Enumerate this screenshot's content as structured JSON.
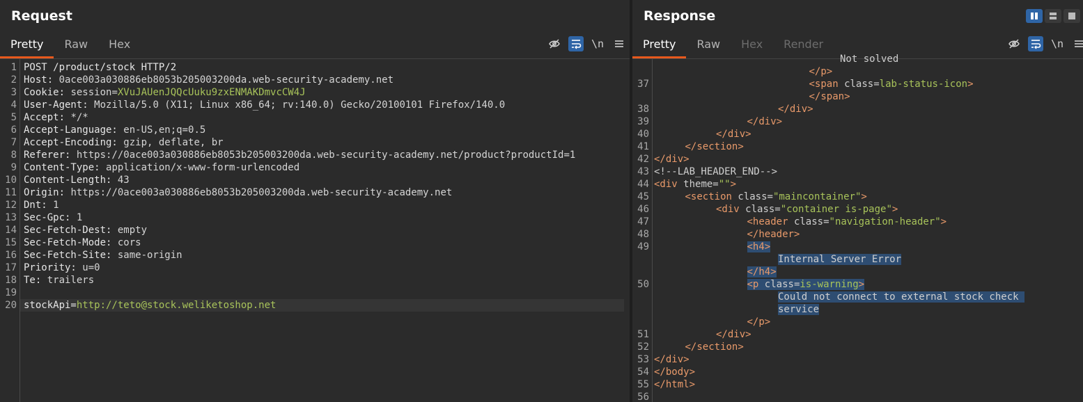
{
  "request": {
    "title": "Request",
    "tabs": [
      {
        "label": "Pretty",
        "active": true
      },
      {
        "label": "Raw",
        "active": false
      },
      {
        "label": "Hex",
        "active": false
      }
    ],
    "tools": {
      "newline_label": "\\n"
    },
    "lines": [
      {
        "n": "1",
        "key": "POST /product/stock HTTP/2",
        "val": "",
        "green": ""
      },
      {
        "n": "2",
        "key": "Host: ",
        "val": "0ace003a030886eb8053b205003200da.web-security-academy.net",
        "green": ""
      },
      {
        "n": "3",
        "key": "Cookie: ",
        "val": "session=",
        "green": "XVuJAUenJQQcUuku9zxENMAKDmvcCW4J"
      },
      {
        "n": "4",
        "key": "User-Agent: ",
        "val": "Mozilla/5.0 (X11; Linux x86_64; rv:140.0) Gecko/20100101 Firefox/140.0",
        "green": ""
      },
      {
        "n": "5",
        "key": "Accept: ",
        "val": "*/*",
        "green": ""
      },
      {
        "n": "6",
        "key": "Accept-Language: ",
        "val": "en-US,en;q=0.5",
        "green": ""
      },
      {
        "n": "7",
        "key": "Accept-Encoding: ",
        "val": "gzip, deflate, br",
        "green": ""
      },
      {
        "n": "8",
        "key": "Referer: ",
        "val": "https://0ace003a030886eb8053b205003200da.web-security-academy.net/product?productId=1",
        "green": ""
      },
      {
        "n": "9",
        "key": "Content-Type: ",
        "val": "application/x-www-form-urlencoded",
        "green": ""
      },
      {
        "n": "10",
        "key": "Content-Length: ",
        "val": "43",
        "green": ""
      },
      {
        "n": "11",
        "key": "Origin: ",
        "val": "https://0ace003a030886eb8053b205003200da.web-security-academy.net",
        "green": ""
      },
      {
        "n": "12",
        "key": "Dnt: ",
        "val": "1",
        "green": ""
      },
      {
        "n": "13",
        "key": "Sec-Gpc: ",
        "val": "1",
        "green": ""
      },
      {
        "n": "14",
        "key": "Sec-Fetch-Dest: ",
        "val": "empty",
        "green": ""
      },
      {
        "n": "15",
        "key": "Sec-Fetch-Mode: ",
        "val": "cors",
        "green": ""
      },
      {
        "n": "16",
        "key": "Sec-Fetch-Site: ",
        "val": "same-origin",
        "green": ""
      },
      {
        "n": "17",
        "key": "Priority: ",
        "val": "u=0",
        "green": ""
      },
      {
        "n": "18",
        "key": "Te: ",
        "val": "trailers",
        "green": ""
      },
      {
        "n": "19",
        "key": "",
        "val": "",
        "green": ""
      },
      {
        "n": "20",
        "key": "stockApi=",
        "val": "",
        "green": "http://teto@stock.weliketoshop.net"
      }
    ]
  },
  "response": {
    "title": "Response",
    "tabs": [
      {
        "label": "Pretty",
        "active": true
      },
      {
        "label": "Raw",
        "active": false
      },
      {
        "label": "Hex",
        "active": false,
        "disabled": true
      },
      {
        "label": "Render",
        "active": false,
        "disabled": true
      }
    ],
    "tools": {
      "newline_label": "\\n"
    },
    "lines": [
      {
        "n": "",
        "indent": 6,
        "parts": [
          {
            "c": "a",
            "t": "Not solved"
          }
        ]
      },
      {
        "n": "",
        "indent": 5,
        "parts": [
          {
            "c": "t",
            "t": "</p>"
          }
        ]
      },
      {
        "n": "37",
        "indent": 5,
        "parts": [
          {
            "c": "t",
            "t": "<span "
          },
          {
            "c": "a",
            "t": "class="
          },
          {
            "c": "s",
            "t": "lab-status-icon"
          },
          {
            "c": "t",
            "t": ">"
          }
        ]
      },
      {
        "n": "",
        "indent": 5,
        "parts": [
          {
            "c": "t",
            "t": "</span>"
          }
        ]
      },
      {
        "n": "38",
        "indent": 4,
        "parts": [
          {
            "c": "t",
            "t": "</div>"
          }
        ]
      },
      {
        "n": "39",
        "indent": 3,
        "parts": [
          {
            "c": "t",
            "t": "</div>"
          }
        ]
      },
      {
        "n": "40",
        "indent": 2,
        "parts": [
          {
            "c": "t",
            "t": "</div>"
          }
        ]
      },
      {
        "n": "41",
        "indent": 1,
        "parts": [
          {
            "c": "t",
            "t": "</section>"
          }
        ]
      },
      {
        "n": "42",
        "indent": 0,
        "parts": [
          {
            "c": "t",
            "t": "</div>"
          }
        ]
      },
      {
        "n": "43",
        "indent": 0,
        "parts": [
          {
            "c": "a",
            "t": "<!--LAB_HEADER_END-->"
          }
        ]
      },
      {
        "n": "44",
        "indent": 0,
        "parts": [
          {
            "c": "t",
            "t": "<div "
          },
          {
            "c": "a",
            "t": "theme="
          },
          {
            "c": "s",
            "t": "\"\""
          },
          {
            "c": "t",
            "t": ">"
          }
        ]
      },
      {
        "n": "45",
        "indent": 1,
        "parts": [
          {
            "c": "t",
            "t": "<section "
          },
          {
            "c": "a",
            "t": "class="
          },
          {
            "c": "s",
            "t": "\"maincontainer\""
          },
          {
            "c": "t",
            "t": ">"
          }
        ]
      },
      {
        "n": "46",
        "indent": 2,
        "parts": [
          {
            "c": "t",
            "t": "<div "
          },
          {
            "c": "a",
            "t": "class="
          },
          {
            "c": "s",
            "t": "\"container is-page\""
          },
          {
            "c": "t",
            "t": ">"
          }
        ]
      },
      {
        "n": "47",
        "indent": 3,
        "parts": [
          {
            "c": "t",
            "t": "<header "
          },
          {
            "c": "a",
            "t": "class="
          },
          {
            "c": "s",
            "t": "\"navigation-header\""
          },
          {
            "c": "t",
            "t": ">"
          }
        ]
      },
      {
        "n": "48",
        "indent": 3,
        "parts": [
          {
            "c": "t",
            "t": "</header>"
          }
        ]
      },
      {
        "n": "49",
        "indent": 3,
        "sel": true,
        "parts": [
          {
            "c": "t",
            "t": "<h4>"
          }
        ]
      },
      {
        "n": "",
        "indent": 4,
        "sel": true,
        "parts": [
          {
            "c": "a",
            "t": "Internal Server Error"
          }
        ]
      },
      {
        "n": "",
        "indent": 3,
        "sel": true,
        "parts": [
          {
            "c": "t",
            "t": "</h4>"
          }
        ]
      },
      {
        "n": "50",
        "indent": 3,
        "sel": true,
        "parts": [
          {
            "c": "t",
            "t": "<p "
          },
          {
            "c": "a",
            "t": "class="
          },
          {
            "c": "s",
            "t": "is-warning"
          },
          {
            "c": "t",
            "t": ">"
          }
        ]
      },
      {
        "n": "",
        "indent": 4,
        "sel": true,
        "parts": [
          {
            "c": "a",
            "t": "Could not connect to external stock check "
          }
        ]
      },
      {
        "n": "",
        "indent": 4,
        "sel": true,
        "parts": [
          {
            "c": "a",
            "t": "service"
          }
        ]
      },
      {
        "n": "",
        "indent": 3,
        "parts": [
          {
            "c": "t",
            "t": "</p>"
          }
        ]
      },
      {
        "n": "51",
        "indent": 2,
        "parts": [
          {
            "c": "t",
            "t": "</div>"
          }
        ]
      },
      {
        "n": "52",
        "indent": 1,
        "parts": [
          {
            "c": "t",
            "t": "</section>"
          }
        ]
      },
      {
        "n": "53",
        "indent": 0,
        "parts": [
          {
            "c": "t",
            "t": "</div>"
          }
        ]
      },
      {
        "n": "54",
        "indent": 0,
        "parts": [
          {
            "c": "t",
            "t": "</body>"
          }
        ]
      },
      {
        "n": "55",
        "indent": 0,
        "parts": [
          {
            "c": "t",
            "t": "</html>"
          }
        ]
      },
      {
        "n": "56",
        "indent": 0,
        "parts": []
      }
    ]
  },
  "icons": {
    "hide": "eye-off-icon",
    "wrap": "wrap-lines-icon",
    "menu": "hamburger-menu-icon"
  },
  "colors": {
    "accent_tab": "#e8591d",
    "active_tool": "#2f65a6",
    "selection": "#2e4d72",
    "string_green": "#a8c35a",
    "tag_orange": "#e99a6a"
  }
}
